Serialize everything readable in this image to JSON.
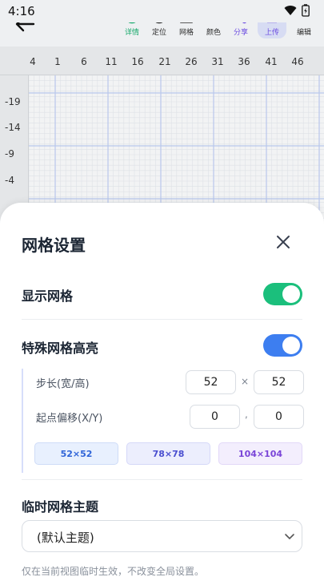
{
  "status": {
    "time": "4:16"
  },
  "toolbar": {
    "tools": [
      {
        "label": "详情",
        "icon": "info-icon"
      },
      {
        "label": "定位",
        "icon": "target-icon"
      },
      {
        "label": "网格",
        "icon": "grid-icon"
      },
      {
        "label": "颜色",
        "icon": "bar-chart-icon"
      },
      {
        "label": "分享",
        "icon": "share-icon"
      },
      {
        "label": "上传",
        "icon": "upload-icon"
      },
      {
        "label": "编辑",
        "icon": "pencil-icon"
      }
    ]
  },
  "canvas": {
    "x_ticks": [
      "4",
      "1",
      "6",
      "11",
      "16",
      "21",
      "26",
      "31",
      "36",
      "41",
      "46"
    ],
    "y_ticks": [
      "-19",
      "-14",
      "-9",
      "-4"
    ]
  },
  "sheet": {
    "title": "网格设置",
    "show_grid": {
      "label": "显示网格",
      "on": true
    },
    "highlight": {
      "label": "特殊网格高亮",
      "on": true
    },
    "step": {
      "label": "步长(宽/高)",
      "width": "52",
      "height": "52",
      "separator": "×"
    },
    "offset": {
      "label": "起点偏移(X/Y)",
      "x": "0",
      "y": "0",
      "separator": ","
    },
    "presets": [
      "52×52",
      "78×78",
      "104×104"
    ],
    "theme": {
      "label": "临时网格主题",
      "value": "(默认主题)"
    },
    "hint": "仅在当前视图临时生效，不改变全局设置。"
  },
  "colors": {
    "green_toggle": "#1bbf7c",
    "blue_toggle": "#3d7ef0",
    "accent_purple": "#6b4be0"
  }
}
